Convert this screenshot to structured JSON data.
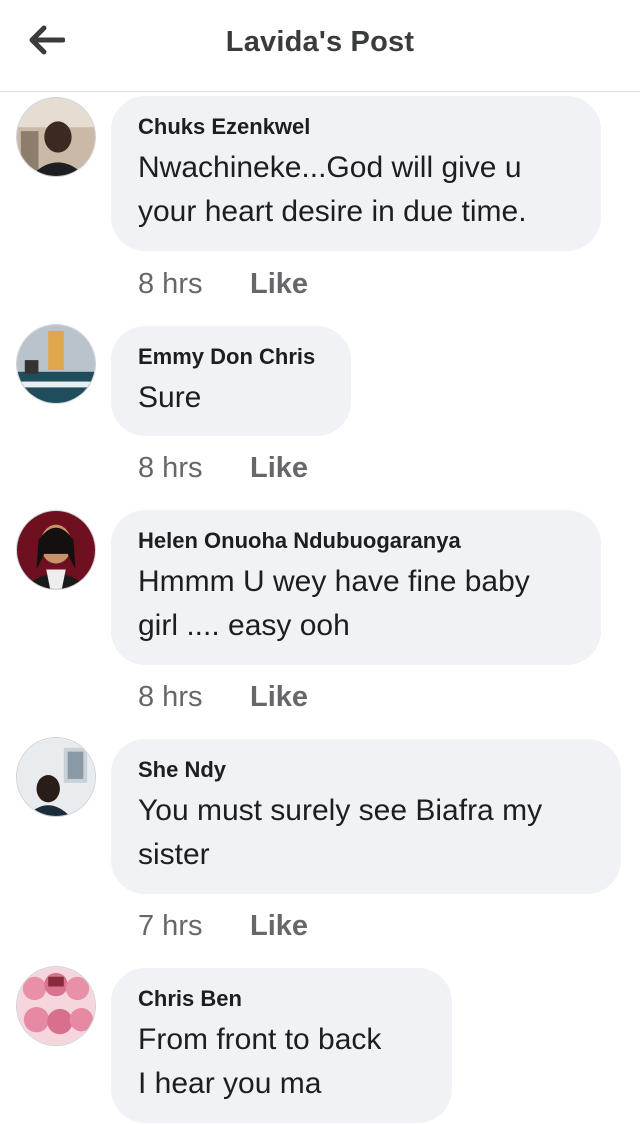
{
  "header": {
    "title": "Lavida's Post",
    "back_icon": "arrow-left-icon"
  },
  "comments": [
    {
      "author": "Chuks Ezenkwel",
      "lines": [
        "Nwachineke...God will give u",
        "your heart desire in due time."
      ],
      "time": "8 hrs",
      "like": "Like"
    },
    {
      "author": "Emmy Don Chris",
      "lines": [
        "Sure"
      ],
      "time": "8 hrs",
      "like": "Like"
    },
    {
      "author": "Helen Onuoha Ndubuogaranya",
      "lines": [
        "Hmmm U wey have fine baby",
        "girl .... easy ooh"
      ],
      "time": "8 hrs",
      "like": "Like"
    },
    {
      "author": "She Ndy",
      "lines": [
        "You must surely see Biafra my",
        "sister"
      ],
      "time": "7 hrs",
      "like": "Like"
    },
    {
      "author": "Chris Ben",
      "lines": [
        "From front to back",
        "I hear you ma"
      ],
      "time": "",
      "like": ""
    }
  ],
  "colors": {
    "bubble": "#f0f2f5",
    "meta_text": "#65676b",
    "header_text": "#3a3b3c"
  }
}
